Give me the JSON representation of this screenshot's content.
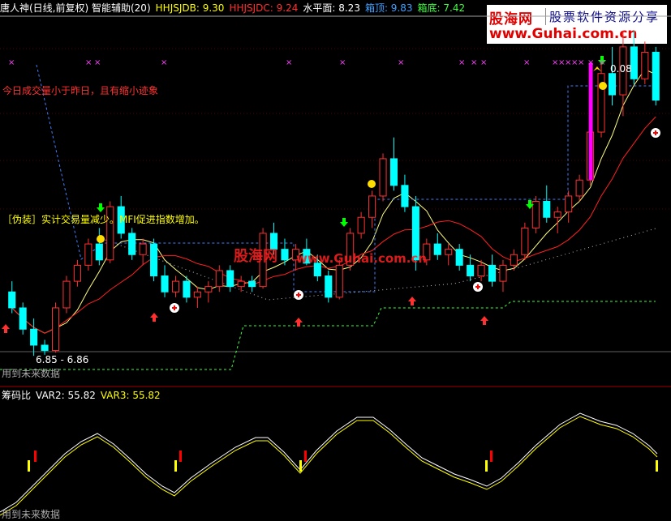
{
  "header": {
    "indicator_name": "唐人神(日线,前复权) 智能辅助(20)",
    "items": [
      {
        "label": "HHJSJDB: 9.30",
        "color": "#ffff00"
      },
      {
        "label": "HHJSJDC: 9.24",
        "color": "#ff3030"
      },
      {
        "label": "水平面: 8.23",
        "color": "#ffffff"
      },
      {
        "label": "箱顶: 9.83",
        "color": "#40a0ff"
      },
      {
        "label": "箱底: 7.42",
        "color": "#40ff40"
      }
    ]
  },
  "logo": {
    "line1_brand": "股海网",
    "line1_tagline": "股票软件资源分享",
    "line2": "www.Guhai.com.cn"
  },
  "watermark": {
    "brand": "股海网",
    "url": "www.Guhai.com.cn"
  },
  "annotations": {
    "volume_note": "今日成交量小于昨日，且有缩小迹象",
    "fake_note": "［伪装］实计交易量减少。MFI促进指数增加。",
    "price_low": "6.85 - 6.86",
    "price_high": "0.08",
    "future_data": "用到未来数据"
  },
  "sub_header": {
    "name": "筹码比",
    "items": [
      {
        "label": "VAR2: 55.82",
        "color": "#ffffff"
      },
      {
        "label": "VAR3: 55.82",
        "color": "#ffff00"
      }
    ]
  },
  "colors": {
    "up": "#ff3030",
    "down": "#00ffff",
    "ma_fast": "#ffff80",
    "ma_slow": "#ff2020",
    "box_top": "#4080ff",
    "box_bottom": "#40ff40"
  },
  "chart_data": {
    "type": "candlestick",
    "title": "唐人神(日线,前复权)",
    "ylim": [
      6.6,
      10.0
    ],
    "candles": [
      [
        7.45,
        7.55,
        7.25,
        7.3
      ],
      [
        7.3,
        7.35,
        7.05,
        7.1
      ],
      [
        7.1,
        7.2,
        6.85,
        6.95
      ],
      [
        6.95,
        7.0,
        6.86,
        6.9
      ],
      [
        6.9,
        7.35,
        6.88,
        7.3
      ],
      [
        7.3,
        7.6,
        7.25,
        7.55
      ],
      [
        7.55,
        7.75,
        7.5,
        7.7
      ],
      [
        7.7,
        7.95,
        7.65,
        7.9
      ],
      [
        7.9,
        8.05,
        7.7,
        7.75
      ],
      [
        7.75,
        8.3,
        7.72,
        8.25
      ],
      [
        8.25,
        8.35,
        7.95,
        8.0
      ],
      [
        8.0,
        8.05,
        7.75,
        7.8
      ],
      [
        7.8,
        7.95,
        7.7,
        7.9
      ],
      [
        7.9,
        7.95,
        7.55,
        7.6
      ],
      [
        7.6,
        7.7,
        7.4,
        7.45
      ],
      [
        7.45,
        7.6,
        7.4,
        7.55
      ],
      [
        7.55,
        7.6,
        7.35,
        7.4
      ],
      [
        7.4,
        7.5,
        7.3,
        7.45
      ],
      [
        7.45,
        7.55,
        7.35,
        7.5
      ],
      [
        7.5,
        7.7,
        7.45,
        7.65
      ],
      [
        7.65,
        7.7,
        7.45,
        7.5
      ],
      [
        7.5,
        7.6,
        7.45,
        7.55
      ],
      [
        7.55,
        7.6,
        7.45,
        7.5
      ],
      [
        7.5,
        8.05,
        7.48,
        8.0
      ],
      [
        8.0,
        8.1,
        7.8,
        7.85
      ],
      [
        7.85,
        7.95,
        7.7,
        7.75
      ],
      [
        7.75,
        7.9,
        7.65,
        7.85
      ],
      [
        7.85,
        7.95,
        7.7,
        7.72
      ],
      [
        7.72,
        7.8,
        7.55,
        7.6
      ],
      [
        7.6,
        7.65,
        7.35,
        7.4
      ],
      [
        7.4,
        7.75,
        7.38,
        7.7
      ],
      [
        7.7,
        8.05,
        7.65,
        8.0
      ],
      [
        8.0,
        8.2,
        7.95,
        8.15
      ],
      [
        8.15,
        8.4,
        8.05,
        8.35
      ],
      [
        8.35,
        8.75,
        8.3,
        8.7
      ],
      [
        8.7,
        8.9,
        8.4,
        8.45
      ],
      [
        8.45,
        8.55,
        8.2,
        8.25
      ],
      [
        8.25,
        8.35,
        7.65,
        7.75
      ],
      [
        7.75,
        7.95,
        7.7,
        7.9
      ],
      [
        7.9,
        8.0,
        7.75,
        7.8
      ],
      [
        7.8,
        7.9,
        7.7,
        7.85
      ],
      [
        7.85,
        7.9,
        7.65,
        7.7
      ],
      [
        7.7,
        7.8,
        7.55,
        7.6
      ],
      [
        7.6,
        7.75,
        7.55,
        7.7
      ],
      [
        7.7,
        7.8,
        7.5,
        7.55
      ],
      [
        7.55,
        7.75,
        7.45,
        7.7
      ],
      [
        7.7,
        7.85,
        7.65,
        7.8
      ],
      [
        7.8,
        8.1,
        7.75,
        8.05
      ],
      [
        8.05,
        8.35,
        8.0,
        8.3
      ],
      [
        8.3,
        8.45,
        8.1,
        8.15
      ],
      [
        8.15,
        8.25,
        8.0,
        8.2
      ],
      [
        8.2,
        8.4,
        8.1,
        8.35
      ],
      [
        8.35,
        8.55,
        8.3,
        8.5
      ],
      [
        8.5,
        9.0,
        8.45,
        8.95
      ],
      [
        8.95,
        9.6,
        8.9,
        9.5
      ],
      [
        9.5,
        9.75,
        9.2,
        9.3
      ],
      [
        9.3,
        9.9,
        9.1,
        9.75
      ],
      [
        9.75,
        9.9,
        9.4,
        9.45
      ],
      [
        9.45,
        9.8,
        9.4,
        9.7
      ],
      [
        9.7,
        9.75,
        9.2,
        9.25
      ]
    ],
    "box_top_series": "9.83",
    "box_bottom_series": "7.42",
    "sub_chart": {
      "name": "筹码比",
      "VAR2": 55.82,
      "VAR3": 55.82
    }
  }
}
